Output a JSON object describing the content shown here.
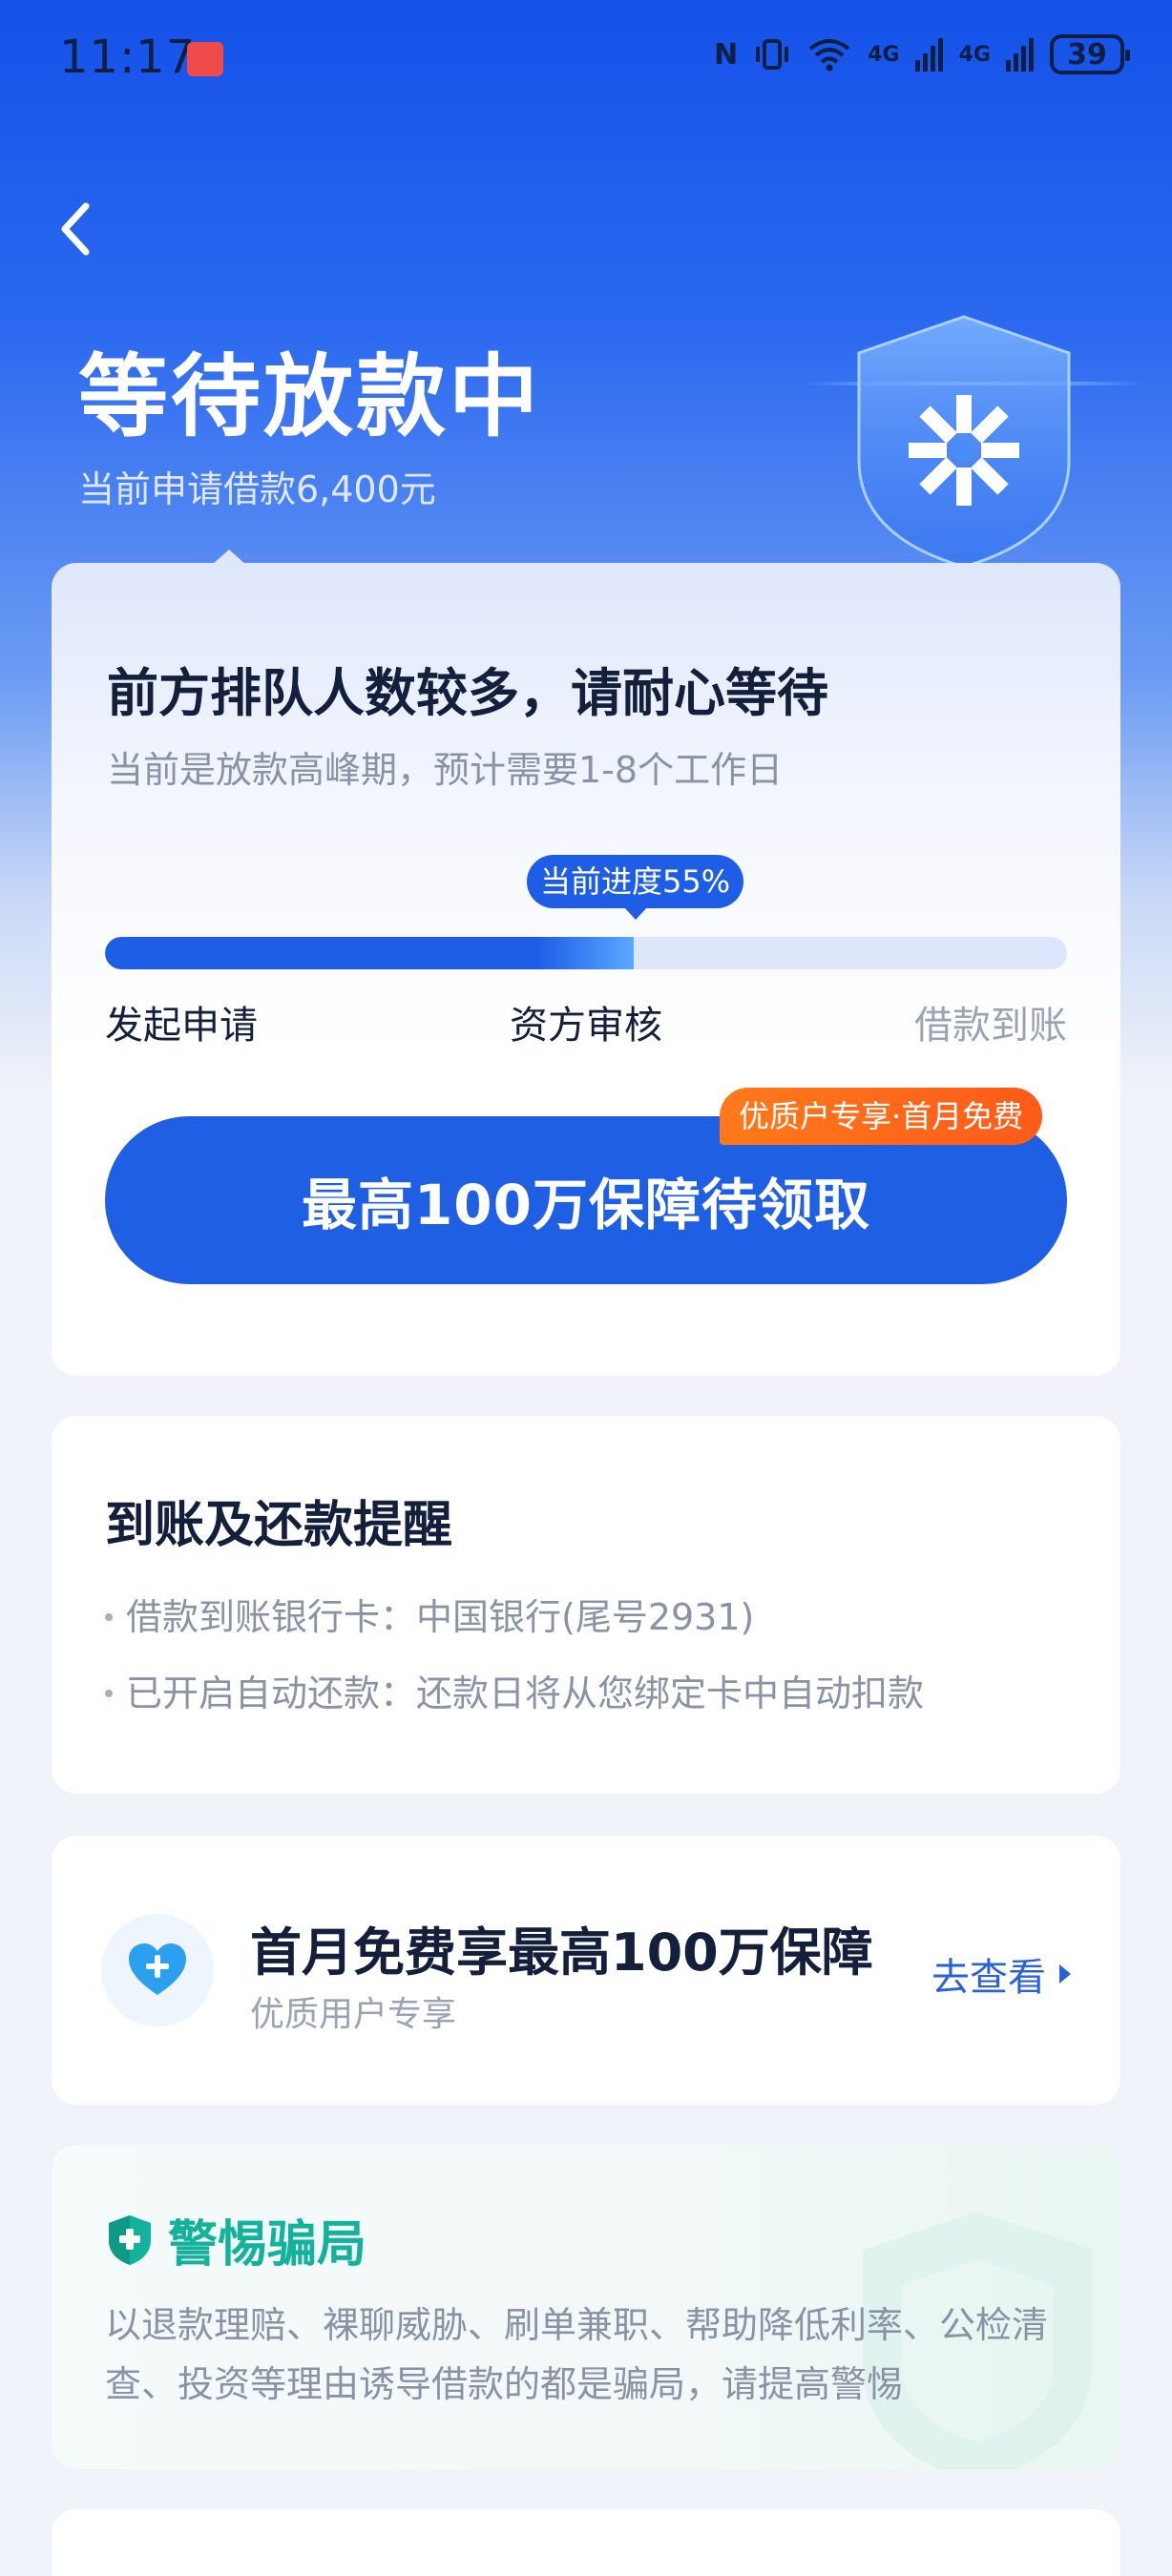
{
  "status_bar": {
    "time": "11:17",
    "nfc_icon": "N",
    "signal_text_1": "4G",
    "signal_text_2": "4G",
    "battery": "39"
  },
  "header": {
    "title": "等待放款中",
    "subtitle": "当前申请借款6,400元"
  },
  "progress_card": {
    "title": "前方排队人数较多，请耐心等待",
    "description": "当前是放款高峰期，预计需要1-8个工作日",
    "progress_label": "当前进度55%",
    "progress_value": 0.55,
    "steps": [
      "发起申请",
      "资方审核",
      "借款到账"
    ],
    "cta_label": "最高100万保障待领取",
    "cta_badge": "优质户专享·首月免费"
  },
  "reminder_card": {
    "title": "到账及还款提醒",
    "lines": [
      "借款到账银行卡：中国银行(尾号2931)",
      "已开启自动还款：还款日将从您绑定卡中自动扣款"
    ]
  },
  "insurance_card": {
    "title": "首月免费享最高100万保障",
    "subtitle": "优质用户专享",
    "link_label": "去查看"
  },
  "fraud_card": {
    "title": "警惕骗局",
    "text": "以退款理赔、裸聊威胁、刷单兼职、帮助降低利率、公检清查、投资等理由诱导借款的都是骗局，请提高警惕"
  },
  "colors": {
    "primary": "#1f5fe4",
    "accent_orange": "#ff6a1a",
    "fraud_green": "#13b29b"
  }
}
